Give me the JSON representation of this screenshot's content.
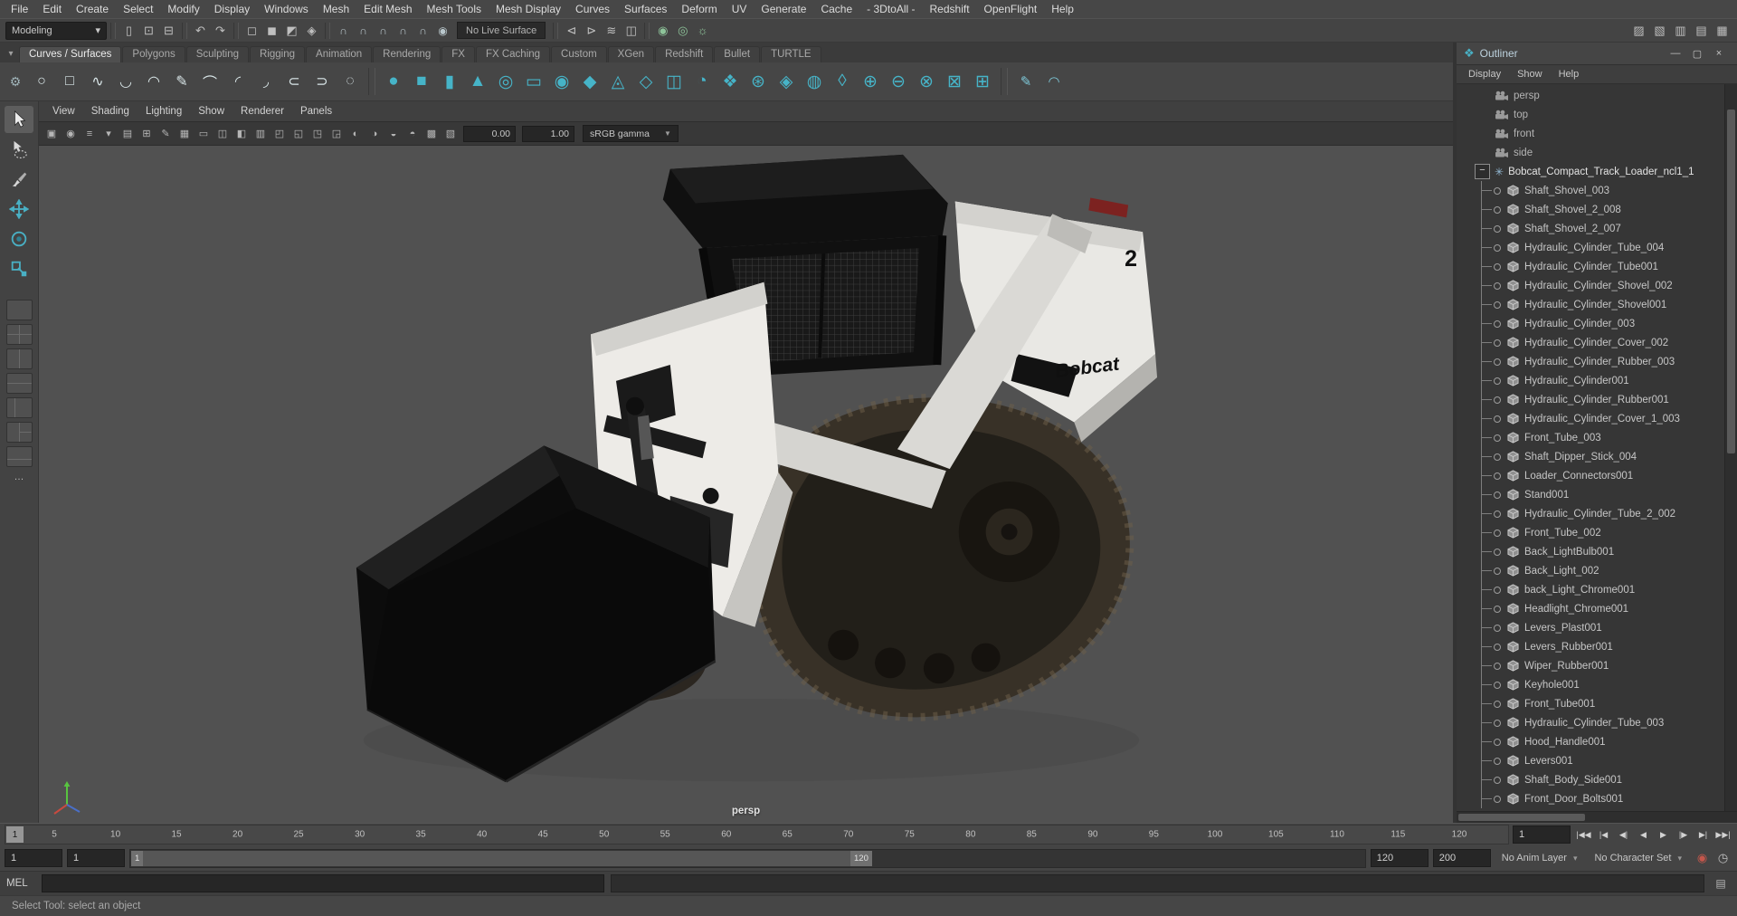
{
  "menu_bar": {
    "items": [
      "File",
      "Edit",
      "Create",
      "Select",
      "Modify",
      "Display",
      "Windows",
      "Mesh",
      "Edit Mesh",
      "Mesh Tools",
      "Mesh Display",
      "Curves",
      "Surfaces",
      "Deform",
      "UV",
      "Generate",
      "Cache",
      "- 3DtoAll -",
      "Redshift",
      "OpenFlight",
      "Help"
    ]
  },
  "status_line": {
    "mode": "Modeling",
    "dropdown_arrow": "▾",
    "file_icons": [
      {
        "name": "new-scene-icon",
        "glyph": "▯"
      },
      {
        "name": "open-scene-icon",
        "glyph": "⊡"
      },
      {
        "name": "save-scene-icon",
        "glyph": "⊟"
      }
    ],
    "edit_icons": [
      {
        "name": "undo-icon",
        "glyph": "↶"
      },
      {
        "name": "redo-icon",
        "glyph": "↷"
      }
    ],
    "selection_icons": [
      {
        "name": "select-hierarchy-icon",
        "glyph": "◻"
      },
      {
        "name": "select-object-icon",
        "glyph": "◼"
      },
      {
        "name": "select-component-icon",
        "glyph": "◩"
      },
      {
        "name": "highlight-selection-mode-icon",
        "glyph": "◈"
      }
    ],
    "snap_icons": [
      {
        "name": "snap-to-grid-icon",
        "glyph": "∩"
      },
      {
        "name": "snap-to-curve-icon",
        "glyph": "∩"
      },
      {
        "name": "snap-to-point-icon",
        "glyph": "∩"
      },
      {
        "name": "snap-to-projected-center-icon",
        "glyph": "∩"
      },
      {
        "name": "snap-to-view-plane-icon",
        "glyph": "∩"
      },
      {
        "name": "make-live-icon",
        "glyph": "◉"
      }
    ],
    "live_surface": "No Live Surface",
    "history_icons": [
      {
        "name": "input-connections-icon",
        "glyph": "⊲"
      },
      {
        "name": "output-connections-icon",
        "glyph": "⊳"
      },
      {
        "name": "construction-history-icon",
        "glyph": "≋"
      },
      {
        "name": "symmetry-icon",
        "glyph": "◫"
      }
    ],
    "render_icons": [
      {
        "name": "render-current-frame-icon",
        "glyph": "◉"
      },
      {
        "name": "ipr-render-icon",
        "glyph": "◎"
      },
      {
        "name": "render-settings-icon",
        "glyph": "☼"
      }
    ],
    "sidebar_icons": [
      {
        "name": "modeling-toolkit-icon",
        "glyph": "▨"
      },
      {
        "name": "humanik-icon",
        "glyph": "▧"
      },
      {
        "name": "attribute-editor-icon",
        "glyph": "▥"
      },
      {
        "name": "tool-settings-icon",
        "glyph": "▤"
      },
      {
        "name": "channel-box-icon",
        "glyph": "▦"
      }
    ]
  },
  "shelf": {
    "tab_menu_icon": {
      "name": "shelf-tab-menu-icon",
      "glyph": "▾"
    },
    "editor_icon": {
      "name": "shelf-editor-icon",
      "glyph": "⚙"
    },
    "tabs": [
      {
        "label": "Curves / Surfaces",
        "state": "active"
      },
      {
        "label": "Polygons"
      },
      {
        "label": "Sculpting"
      },
      {
        "label": "Rigging"
      },
      {
        "label": "Animation"
      },
      {
        "label": "Rendering"
      },
      {
        "label": "FX"
      },
      {
        "label": "FX Caching"
      },
      {
        "label": "Custom"
      },
      {
        "label": "XGen"
      },
      {
        "label": "Redshift"
      },
      {
        "label": "Bullet"
      },
      {
        "label": "TURTLE"
      }
    ],
    "curve_icons": [
      {
        "name": "nurbs-circle-icon",
        "glyph": "○"
      },
      {
        "name": "nurbs-square-icon",
        "glyph": "□"
      },
      {
        "name": "cv-curve-tool-icon",
        "glyph": "∿"
      },
      {
        "name": "ep-curve-tool-icon",
        "glyph": "◡"
      },
      {
        "name": "bezier-curve-tool-icon",
        "glyph": "◠"
      },
      {
        "name": "pencil-curve-tool-icon",
        "glyph": "✎"
      },
      {
        "name": "arc-three-point-icon",
        "glyph": "⌒"
      },
      {
        "name": "arc-two-point-icon",
        "glyph": "◜"
      },
      {
        "name": "curve-fillet-icon",
        "glyph": "◞"
      },
      {
        "name": "attach-curves-icon",
        "glyph": "⊂"
      },
      {
        "name": "detach-curves-icon",
        "glyph": "⊃"
      },
      {
        "name": "open-close-curve-icon",
        "glyph": "◌"
      }
    ],
    "poly_icons": [
      {
        "name": "poly-sphere-icon",
        "glyph": "●"
      },
      {
        "name": "poly-cube-icon",
        "glyph": "■"
      },
      {
        "name": "poly-cylinder-icon",
        "glyph": "▮"
      },
      {
        "name": "poly-cone-icon",
        "glyph": "▲"
      },
      {
        "name": "poly-torus-icon",
        "glyph": "◎"
      },
      {
        "name": "poly-plane-icon",
        "glyph": "▭"
      },
      {
        "name": "poly-disc-icon",
        "glyph": "◉"
      },
      {
        "name": "poly-platonic-icon",
        "glyph": "◆"
      },
      {
        "name": "poly-pyramid-icon",
        "glyph": "◬"
      },
      {
        "name": "poly-prism-icon",
        "glyph": "◇"
      },
      {
        "name": "poly-pipe-icon",
        "glyph": "◫"
      },
      {
        "name": "poly-helix-icon",
        "glyph": "◔"
      },
      {
        "name": "poly-gear-icon",
        "glyph": "❖"
      },
      {
        "name": "poly-soccer-ball-icon",
        "glyph": "⊛"
      },
      {
        "name": "poly-superellipse-icon",
        "glyph": "◈"
      },
      {
        "name": "poly-spherical-harmonics-icon",
        "glyph": "◍"
      },
      {
        "name": "poly-ultra-shape-icon",
        "glyph": "◊"
      },
      {
        "name": "boolean-union-icon",
        "glyph": "⊕"
      },
      {
        "name": "boolean-difference-icon",
        "glyph": "⊖"
      },
      {
        "name": "boolean-intersection-icon",
        "glyph": "⊗"
      },
      {
        "name": "multi-cut-icon",
        "glyph": "⊠"
      },
      {
        "name": "quad-draw-icon",
        "glyph": "⊞"
      }
    ],
    "sculpt_icons": [
      {
        "name": "sculpt-tool-icon",
        "glyph": "✎"
      },
      {
        "name": "smooth-tool-icon",
        "glyph": "◠"
      }
    ]
  },
  "toolbox": {
    "tools": [
      "select-tool",
      "lasso-tool",
      "paint-select-tool",
      "move-tool",
      "rotate-tool",
      "scale-tool"
    ],
    "more_label": "…"
  },
  "viewport": {
    "menus": [
      "View",
      "Shading",
      "Lighting",
      "Show",
      "Renderer",
      "Panels"
    ],
    "toolbar_icons": [
      {
        "name": "select-camera-icon",
        "glyph": "▣"
      },
      {
        "name": "lock-camera-icon",
        "glyph": "◉"
      },
      {
        "name": "camera-attributes-icon",
        "glyph": "≡"
      },
      {
        "name": "bookmarks-icon",
        "glyph": "▾"
      },
      {
        "name": "image-plane-icon",
        "glyph": "▤"
      },
      {
        "name": "two-d-pan-zoom-icon",
        "glyph": "⊞"
      },
      {
        "name": "grease-pencil-icon",
        "glyph": "✎"
      },
      {
        "name": "grid-icon",
        "glyph": "▦"
      },
      {
        "name": "film-gate-icon",
        "glyph": "▭"
      },
      {
        "name": "resolution-gate-icon",
        "glyph": "◫"
      },
      {
        "name": "gate-mask-icon",
        "glyph": "◧"
      },
      {
        "name": "field-chart-icon",
        "glyph": "▥"
      },
      {
        "name": "safe-action-icon",
        "glyph": "◰"
      },
      {
        "name": "safe-title-icon",
        "glyph": "◱"
      },
      {
        "name": "frame-all-icon",
        "glyph": "◳"
      },
      {
        "name": "frame-selection-icon",
        "glyph": "◲"
      },
      {
        "name": "lighting-icon",
        "glyph": "◐"
      },
      {
        "name": "shadows-icon",
        "glyph": "◑"
      },
      {
        "name": "ambient-occlusion-icon",
        "glyph": "◒"
      },
      {
        "name": "motion-blur-icon",
        "glyph": "◓"
      },
      {
        "name": "anti-aliasing-icon",
        "glyph": "▩"
      },
      {
        "name": "xray-icon",
        "glyph": "▧"
      }
    ],
    "exposure_value": "0.00",
    "gamma_value": "1.00",
    "color_space": "sRGB gamma",
    "dropdown_arrow": "▼",
    "camera_label": "persp"
  },
  "model": {
    "logo_text": "Bobcat",
    "badge_text": "2"
  },
  "outliner": {
    "title": "Outliner",
    "title_icon": "❖",
    "window_buttons": [
      {
        "name": "minimize-button",
        "glyph": "—"
      },
      {
        "name": "maximize-button",
        "glyph": "▢"
      },
      {
        "name": "close-button",
        "glyph": "×"
      }
    ],
    "menus": [
      "Display",
      "Show",
      "Help"
    ],
    "cameras": [
      "persp",
      "top",
      "front",
      "side"
    ],
    "root_expander": "−",
    "root_icon": "✳",
    "root_label": "Bobcat_Compact_Track_Loader_ncl1_1",
    "children": [
      "Shaft_Shovel_003",
      "Shaft_Shovel_2_008",
      "Shaft_Shovel_2_007",
      "Hydraulic_Cylinder_Tube_004",
      "Hydraulic_Cylinder_Tube001",
      "Hydraulic_Cylinder_Shovel_002",
      "Hydraulic_Cylinder_Shovel001",
      "Hydraulic_Cylinder_003",
      "Hydraulic_Cylinder_Cover_002",
      "Hydraulic_Cylinder_Rubber_003",
      "Hydraulic_Cylinder001",
      "Hydraulic_Cylinder_Rubber001",
      "Hydraulic_Cylinder_Cover_1_003",
      "Front_Tube_003",
      "Shaft_Dipper_Stick_004",
      "Loader_Connectors001",
      "Stand001",
      "Hydraulic_Cylinder_Tube_2_002",
      "Front_Tube_002",
      "Back_LightBulb001",
      "Back_Light_002",
      "back_Light_Chrome001",
      "Headlight_Chrome001",
      "Levers_Plast001",
      "Levers_Rubber001",
      "Wiper_Rubber001",
      "Keyhole001",
      "Front_Tube001",
      "Hydraulic_Cylinder_Tube_003",
      "Hood_Handle001",
      "Levers001",
      "Shaft_Body_Side001",
      "Front_Door_Bolts001"
    ]
  },
  "timeline": {
    "current_frame": "1",
    "ticks": [
      {
        "label": "5",
        "pos": 3.25
      },
      {
        "label": "10",
        "pos": 7.32
      },
      {
        "label": "15",
        "pos": 11.38
      },
      {
        "label": "20",
        "pos": 15.45
      },
      {
        "label": "25",
        "pos": 19.51
      },
      {
        "label": "30",
        "pos": 23.58
      },
      {
        "label": "35",
        "pos": 27.64
      },
      {
        "label": "40",
        "pos": 31.71
      },
      {
        "label": "45",
        "pos": 35.77
      },
      {
        "label": "50",
        "pos": 39.84
      },
      {
        "label": "55",
        "pos": 43.9
      },
      {
        "label": "60",
        "pos": 47.97
      },
      {
        "label": "65",
        "pos": 52.03
      },
      {
        "label": "70",
        "pos": 56.1
      },
      {
        "label": "75",
        "pos": 60.16
      },
      {
        "label": "80",
        "pos": 64.23
      },
      {
        "label": "85",
        "pos": 68.29
      },
      {
        "label": "90",
        "pos": 72.36
      },
      {
        "label": "95",
        "pos": 76.42
      },
      {
        "label": "100",
        "pos": 80.49
      },
      {
        "label": "105",
        "pos": 84.55
      },
      {
        "label": "110",
        "pos": 88.62
      },
      {
        "label": "115",
        "pos": 92.68
      },
      {
        "label": "120",
        "pos": 96.75
      }
    ],
    "time_field": "1",
    "playback_buttons": [
      {
        "name": "go-to-start-button",
        "glyph": "|◀◀"
      },
      {
        "name": "step-back-frame-button",
        "glyph": "|◀"
      },
      {
        "name": "step-back-key-button",
        "glyph": "◀|"
      },
      {
        "name": "play-backwards-button",
        "glyph": "◀"
      },
      {
        "name": "play-forwards-button",
        "glyph": "▶"
      },
      {
        "name": "step-forward-key-button",
        "glyph": "|▶"
      },
      {
        "name": "step-forward-frame-button",
        "glyph": "▶|"
      },
      {
        "name": "go-to-end-button",
        "glyph": "▶▶|"
      }
    ]
  },
  "range_slider": {
    "anim_start": "1",
    "playback_start": "1",
    "bar_start": "1",
    "bar_end": "120",
    "playback_end": "120",
    "anim_end": "200",
    "anim_layer": "No Anim Layer",
    "character_set": "No Character Set",
    "dd_arrow": "▾",
    "icons": [
      {
        "name": "auto-keyframe-icon",
        "glyph": "◉",
        "tone": "red"
      },
      {
        "name": "animation-preferences-icon",
        "glyph": "◷",
        "tone": ""
      }
    ]
  },
  "command_line": {
    "label": "MEL",
    "script_editor_icon": "▤"
  },
  "help_line": {
    "text": "Select Tool: select an object"
  }
}
